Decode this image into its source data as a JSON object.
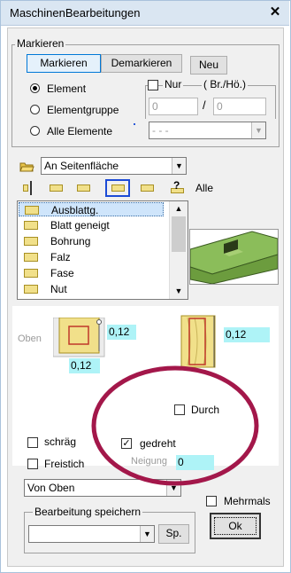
{
  "window": {
    "title": "MaschinenBearbeitungen",
    "close_label": "✕"
  },
  "markieren": {
    "legend": "Markieren",
    "markieren_label": "Markieren",
    "demarkieren_label": "Demarkieren",
    "neu_label": "Neu",
    "radios": [
      {
        "label": "Element",
        "selected": true
      },
      {
        "label": "Elementgruppe",
        "selected": false
      },
      {
        "label": "Alle Elemente",
        "selected": false
      }
    ],
    "nur_label": "Nur",
    "brho_label": "( Br./Hö.)",
    "field1_value": "0",
    "slash": "/",
    "field2_value": "0",
    "combo_value": "- - -"
  },
  "face": {
    "combo_value": "An Seitenfläche",
    "alle_label": "Alle",
    "help_label": "?"
  },
  "list": {
    "items": [
      "Ausblattg.",
      "Blatt geneigt",
      "Bohrung",
      "Falz",
      "Fase",
      "Nut"
    ],
    "selected_index": 0
  },
  "params": {
    "oben_label": "Oben",
    "dim_right": "0,12",
    "dim_bottom": "0,12",
    "dim_side": "0,12",
    "durch_label": "Durch",
    "schraeg_label": "schräg",
    "gedreht_label": "gedreht",
    "gedreht_checked": true,
    "freistich_label": "Freistich",
    "neigung_label": "Neigung",
    "neigung_value": "0",
    "direction_value": "Von Oben",
    "mehrmals_label": "Mehrmals"
  },
  "save": {
    "legend": "Bearbeitung speichern",
    "combo_value": "",
    "sp_label": "Sp.",
    "ok_label": "Ok"
  },
  "colors": {
    "highlight_circle": "#a3174a",
    "cyan_field": "#aef3f7",
    "wood": "#f1e08a"
  }
}
